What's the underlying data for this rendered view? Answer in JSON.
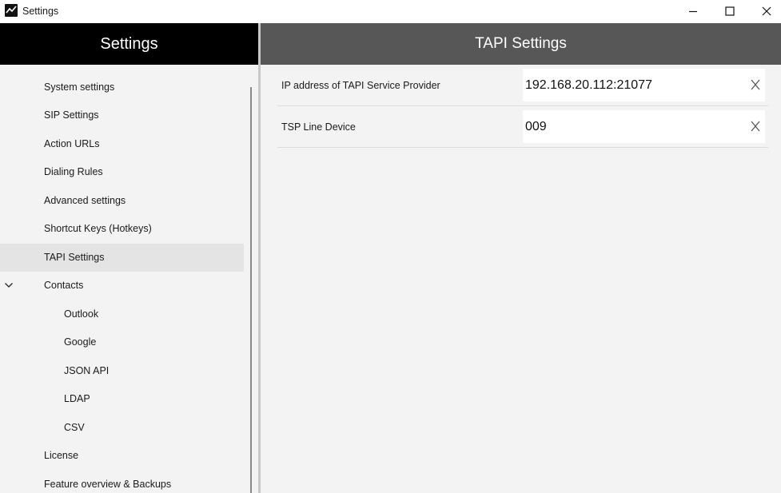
{
  "window": {
    "title": "Settings",
    "controls": [
      "minimize-icon",
      "maximize-icon",
      "close-icon"
    ]
  },
  "sidebar": {
    "header": "Settings",
    "items": [
      {
        "label": "System settings",
        "level": 0
      },
      {
        "label": "SIP Settings",
        "level": 0
      },
      {
        "label": "Action URLs",
        "level": 0
      },
      {
        "label": "Dialing Rules",
        "level": 0
      },
      {
        "label": "Advanced settings",
        "level": 0
      },
      {
        "label": "Shortcut Keys (Hotkeys)",
        "level": 0
      },
      {
        "label": "TAPI Settings",
        "level": 0,
        "selected": true
      },
      {
        "label": "Contacts",
        "level": 0,
        "expanded": true,
        "icon": "chevron-down-icon"
      },
      {
        "label": "Outlook",
        "level": 1
      },
      {
        "label": "Google",
        "level": 1
      },
      {
        "label": "JSON API",
        "level": 1
      },
      {
        "label": "LDAP",
        "level": 1
      },
      {
        "label": "CSV",
        "level": 1
      },
      {
        "label": "License",
        "level": 0
      },
      {
        "label": "Feature overview & Backups",
        "level": 0
      }
    ]
  },
  "main": {
    "header": "TAPI Settings",
    "fields": [
      {
        "label": "IP address of TAPI Service Provider",
        "value": "192.168.20.112:21077",
        "clear_icon": "clear-icon"
      },
      {
        "label": "TSP Line Device",
        "value": "009",
        "clear_icon": "clear-icon"
      }
    ]
  },
  "colors": {
    "sidebar_header_bg": "#000000",
    "main_header_bg": "#575757",
    "panel_bg": "#f3f3f3",
    "selected_item_bg": "#e4e4e4"
  }
}
